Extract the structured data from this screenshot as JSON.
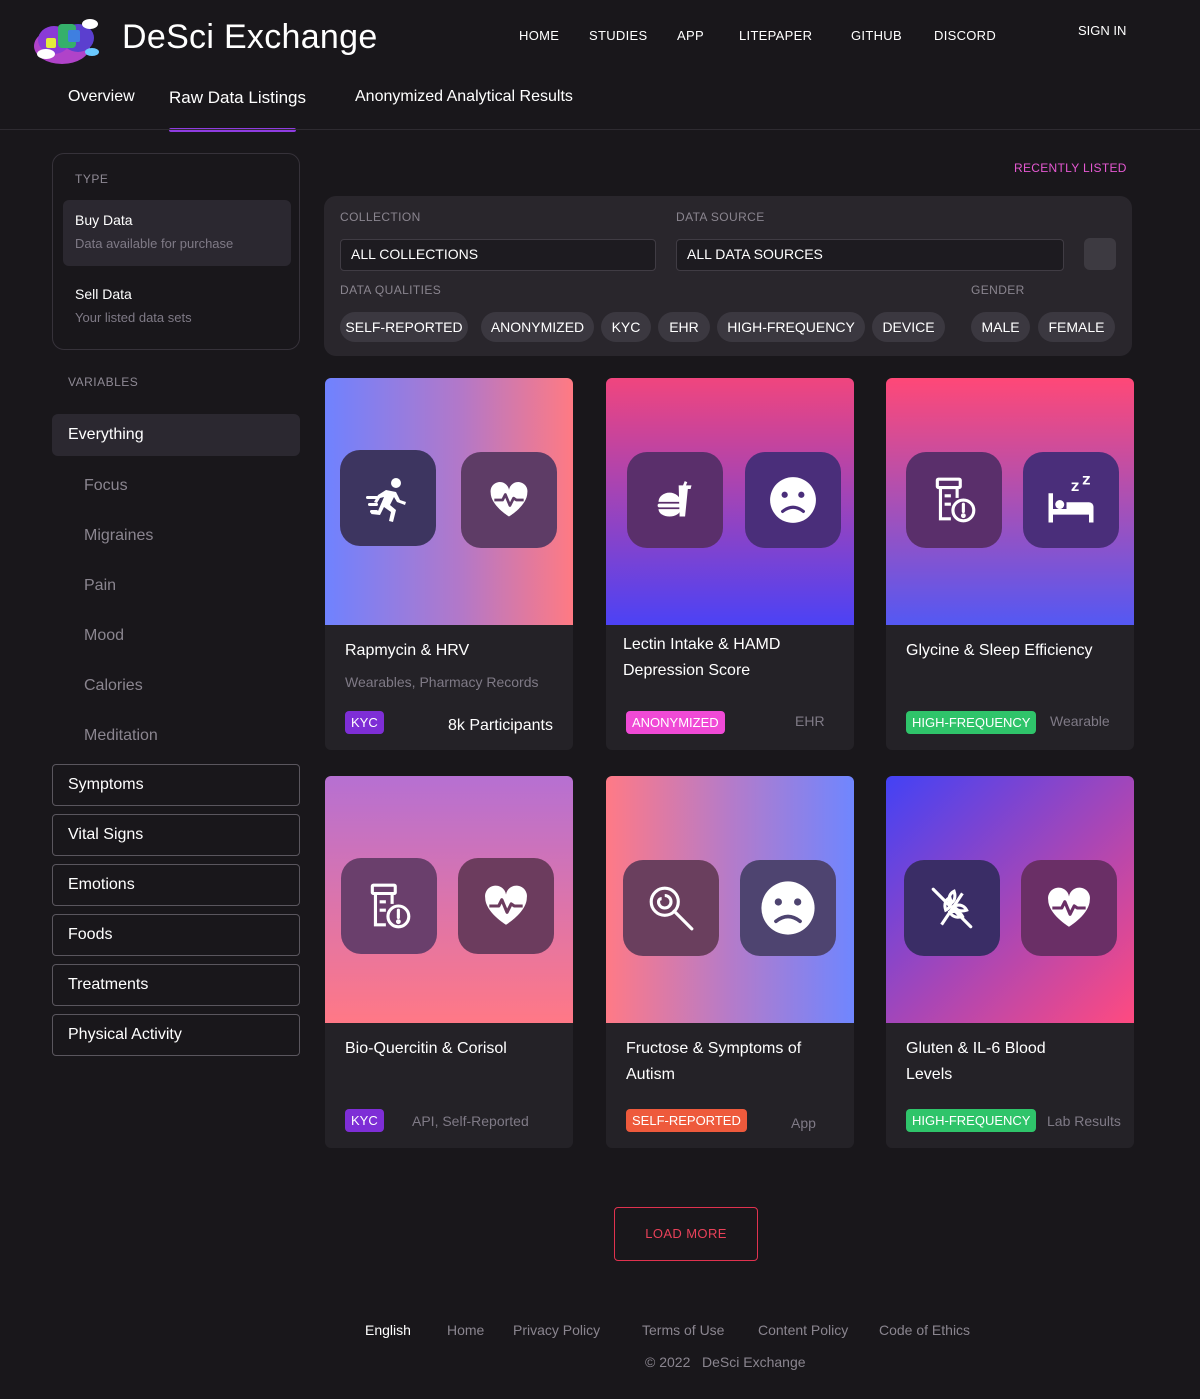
{
  "header": {
    "brand": "DeSci Exchange",
    "nav": [
      "HOME",
      "STUDIES",
      "APP",
      "LITEPAPER",
      "GITHUB",
      "DISCORD"
    ],
    "sign_in": "SIGN IN"
  },
  "tabs": {
    "overview": "Overview",
    "raw_data": "Raw Data Listings",
    "analytical": "Anonymized Analytical Results",
    "active": "Raw Data Listings"
  },
  "sidebar": {
    "type_label": "TYPE",
    "buy_title": "Buy Data",
    "buy_sub": "Data available for purchase",
    "sell_title": "Sell Data",
    "sell_sub": "Your listed data sets",
    "variables_label": "VARIABLES",
    "everything": "Everything",
    "subitems": [
      "Focus",
      "Migraines",
      "Pain",
      "Mood",
      "Calories",
      "Meditation"
    ],
    "categories": [
      "Symptoms",
      "Vital Signs",
      "Emotions",
      "Foods",
      "Treatments",
      "Physical Activity"
    ]
  },
  "filters": {
    "recently_listed": "RECENTLY LISTED",
    "collection_label": "COLLECTION",
    "collection_value": "ALL COLLECTIONS",
    "source_label": "DATA SOURCE",
    "source_value": "ALL DATA SOURCES",
    "qualities_label": "DATA QUALITIES",
    "qualities": [
      "SELF-REPORTED",
      "ANONYMIZED",
      "KYC",
      "EHR",
      "HIGH-FREQUENCY",
      "DEVICE"
    ],
    "gender_label": "GENDER",
    "genders": [
      "MALE",
      "FEMALE"
    ]
  },
  "cards": [
    {
      "title": "Rapmycin & HRV",
      "source": "Wearables, Pharmacy Records",
      "badge": "KYC",
      "badge_color": "#7e2ed6",
      "participants": "8k Participants",
      "icons": [
        "running-icon",
        "heart-pulse-icon"
      ]
    },
    {
      "title": "Lectin Intake & HAMD Depression Score",
      "source": "EHR",
      "badge": "ANONYMIZED",
      "badge_color": "#f04ad6",
      "icons": [
        "fast-food-icon",
        "sad-face-icon"
      ]
    },
    {
      "title": "Glycine & Sleep Efficiency",
      "source": "Wearable",
      "badge": "HIGH-FREQUENCY",
      "badge_color": "#2fc46a",
      "icons": [
        "pill-bottle-alert-icon",
        "bed-sleep-icon"
      ]
    },
    {
      "title": "Bio-Quercitin & Corisol",
      "source": "API, Self-Reported",
      "badge": "KYC",
      "badge_color": "#7e2ed6",
      "icons": [
        "pill-bottle-alert-icon",
        "heart-pulse-icon"
      ]
    },
    {
      "title": "Fructose & Symptoms of Autism",
      "source": "App",
      "badge": "SELF-REPORTED",
      "badge_color": "#ee5a3c",
      "icons": [
        "lollipop-icon",
        "sad-face-icon"
      ]
    },
    {
      "title": "Gluten & IL-6 Blood Levels",
      "source": "Lab Results",
      "badge": "HIGH-FREQUENCY",
      "badge_color": "#2fc46a",
      "icons": [
        "gluten-free-icon",
        "heart-pulse-icon"
      ]
    }
  ],
  "load_more": "LOAD MORE",
  "footer": {
    "language": "English",
    "links": [
      "Home",
      "Privacy Policy",
      "Terms of Use",
      "Content Policy",
      "Code of Ethics"
    ],
    "copyright": "© 2022   DeSci Exchange"
  }
}
